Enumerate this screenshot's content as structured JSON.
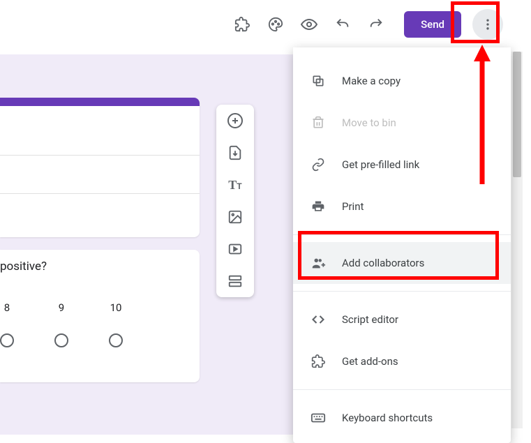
{
  "toolbar": {
    "send_label": "Send"
  },
  "question": {
    "text_fragment": "positive?",
    "scale": [
      "8",
      "9",
      "10"
    ]
  },
  "menu": {
    "make_copy": "Make a copy",
    "move_to_bin": "Move to bin",
    "get_prefilled": "Get pre-filled link",
    "print": "Print",
    "add_collaborators": "Add collaborators",
    "script_editor": "Script editor",
    "get_addons": "Get add-ons",
    "keyboard_shortcuts": "Keyboard shortcuts"
  }
}
